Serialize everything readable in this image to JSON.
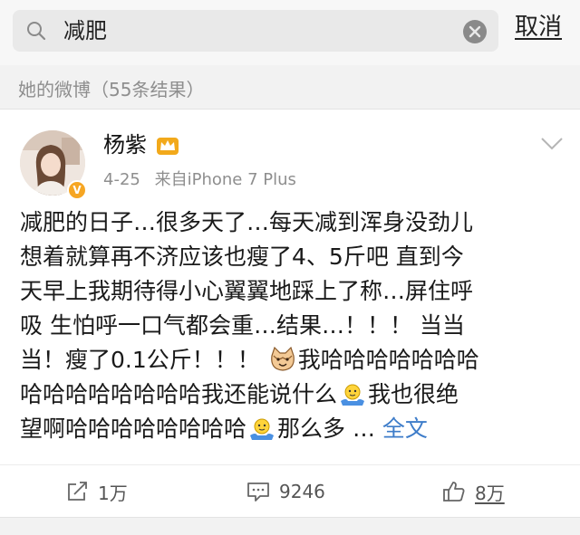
{
  "search": {
    "query": "减肥",
    "cancel_label": "取消"
  },
  "section": {
    "label": "她的微博（55条结果）"
  },
  "post": {
    "author": "杨紫",
    "date": "4-25",
    "source": "来自iPhone 7 Plus",
    "text_line1": "减肥的日子…很多天了…每天减到浑身没劲儿",
    "text_line2": "想着就算再不济应该也瘦了4、5斤吧 直到今",
    "text_line3": "天早上我期待得小心翼翼地踩上了称…屏住呼",
    "text_line4": "吸 生怕呼一口气都会重…结果…！！！ 当当",
    "text_line5a": "当！瘦了0.1公斤！！！ ",
    "text_line5b": "我哈哈哈哈哈哈哈",
    "text_line6a": "哈哈哈哈哈哈哈哈我还能说什么",
    "text_line6b": "我也很绝",
    "text_line7a": "望啊哈哈哈哈哈哈哈哈",
    "text_line7b": "那么多 … ",
    "full_text_link": "全文",
    "emoji_icons": [
      "cat-face-emoji-icon",
      "shrug-emoji-icon",
      "shrug-emoji-icon"
    ]
  },
  "actions": {
    "repost_count": "1万",
    "comment_count": "9246",
    "like_count": "8万"
  },
  "colors": {
    "link": "#3d7cc9",
    "badge": "#f6a623",
    "crown": "#f2a91b"
  }
}
